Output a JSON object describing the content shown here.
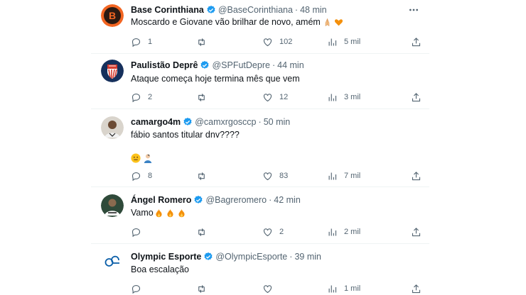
{
  "tweets": [
    {
      "name": "Base Corinthiana",
      "handle": "@BaseCorinthiana",
      "time": "48 min",
      "text": "Moscardo e Giovane  vão brilhar de novo, amém",
      "text_emojis": [
        "folded-hands",
        "orange-heart"
      ],
      "replies": "1",
      "retweets": "",
      "likes": "102",
      "views": "5 mil",
      "avatar": "base-corinthiana-logo"
    },
    {
      "name": "Paulistão Deprê",
      "handle": "@SPFutDepre",
      "time": "44 min",
      "text": "Ataque começa hoje termina mês que vem",
      "text_emojis": [],
      "replies": "2",
      "retweets": "",
      "likes": "12",
      "views": "3 mil",
      "avatar": "paulistao-depre-crest"
    },
    {
      "name": "camargo4m",
      "handle": "@camxrgosccp",
      "time": "50 min",
      "text": "fábio santos titular dnv????",
      "text_emojis": [],
      "extra_emojis": [
        "neutral-face",
        "person-emoji"
      ],
      "replies": "8",
      "retweets": "",
      "likes": "83",
      "views": "7 mil",
      "avatar": "user-photo"
    },
    {
      "name": "Ángel Romero",
      "handle": "@Bagreromero",
      "time": "42 min",
      "text": "Vamo",
      "text_emojis": [
        "fire",
        "fire",
        "fire"
      ],
      "replies": "",
      "retweets": "",
      "likes": "2",
      "views": "2 mil",
      "avatar": "user-photo"
    },
    {
      "name": "Olympic Esporte",
      "handle": "@OlympicEsporte",
      "time": "39 min",
      "text": "Boa escalação",
      "text_emojis": [],
      "replies": "",
      "retweets": "",
      "likes": "",
      "views": "1 mil",
      "avatar": "olympic-esporte-logo"
    }
  ],
  "colors": {
    "verified": "#1d9bf0",
    "muted": "#536471",
    "text": "#0f1419",
    "divider": "#eff3f4",
    "corinthiana_orange": "#f26522"
  },
  "separator": "·",
  "more_icon": "more-horizontal-icon"
}
